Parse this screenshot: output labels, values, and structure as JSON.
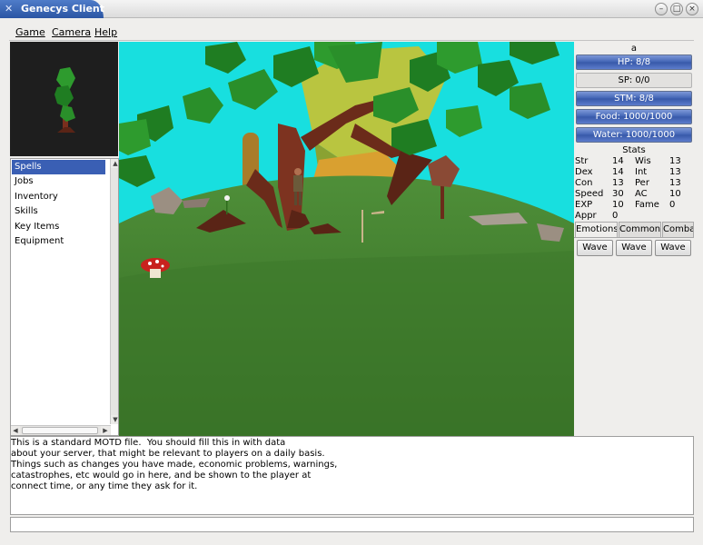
{
  "window": {
    "title": "Genecys Client",
    "icon": "x-icon",
    "controls": [
      "minimize",
      "maximize",
      "close"
    ]
  },
  "menu": {
    "items": [
      {
        "label": "Game"
      },
      {
        "label": "Camera"
      },
      {
        "label": "Help"
      }
    ]
  },
  "tree": {
    "items": [
      {
        "label": "Spells",
        "selected": true
      },
      {
        "label": "Jobs"
      },
      {
        "label": "Inventory"
      },
      {
        "label": "Skills"
      },
      {
        "label": "Key Items"
      },
      {
        "label": "Equipment"
      }
    ]
  },
  "character": {
    "name": "a",
    "bars": [
      {
        "label": "HP: 8/8",
        "fill": 1.0
      },
      {
        "label": "SP: 0/0",
        "fill": 0.0
      },
      {
        "label": "STM: 8/8",
        "fill": 1.0
      },
      {
        "label": "Food: 1000/1000",
        "fill": 1.0
      },
      {
        "label": "Water: 1000/1000",
        "fill": 1.0
      }
    ]
  },
  "stats": {
    "title": "Stats",
    "left": [
      {
        "name": "Str",
        "value": "14"
      },
      {
        "name": "Dex",
        "value": "14"
      },
      {
        "name": "Con",
        "value": "13"
      },
      {
        "name": "Speed",
        "value": "30"
      },
      {
        "name": "EXP",
        "value": "10"
      },
      {
        "name": "Appr",
        "value": "0"
      }
    ],
    "right": [
      {
        "name": "Wis",
        "value": "13"
      },
      {
        "name": "Int",
        "value": "13"
      },
      {
        "name": "Per",
        "value": "13"
      },
      {
        "name": "AC",
        "value": "10"
      },
      {
        "name": "Fame",
        "value": "0"
      }
    ]
  },
  "tabs": [
    {
      "label": "Emotions",
      "active": true
    },
    {
      "label": "Common"
    },
    {
      "label": "Comba"
    }
  ],
  "emotes": [
    {
      "label": "Wave"
    },
    {
      "label": "Wave"
    },
    {
      "label": "Wave"
    }
  ],
  "motd": {
    "lines": [
      "This is a standard MOTD file.  You should fill this in with data",
      "about your server, that might be relevant to players on a daily basis.",
      "Things such as changes you have made, economic problems, warnings,",
      "catastrophes, etc would go in here, and be shown to the player at",
      "connect time, or any time they ask for it."
    ]
  },
  "chat_input": {
    "value": ""
  },
  "colors": {
    "title_blue": "#2b55a3",
    "bar_blue": "#3f62b3",
    "sky": "#18dfdf",
    "grass": "#3f7a2c",
    "selection": "#3a5fb4"
  }
}
